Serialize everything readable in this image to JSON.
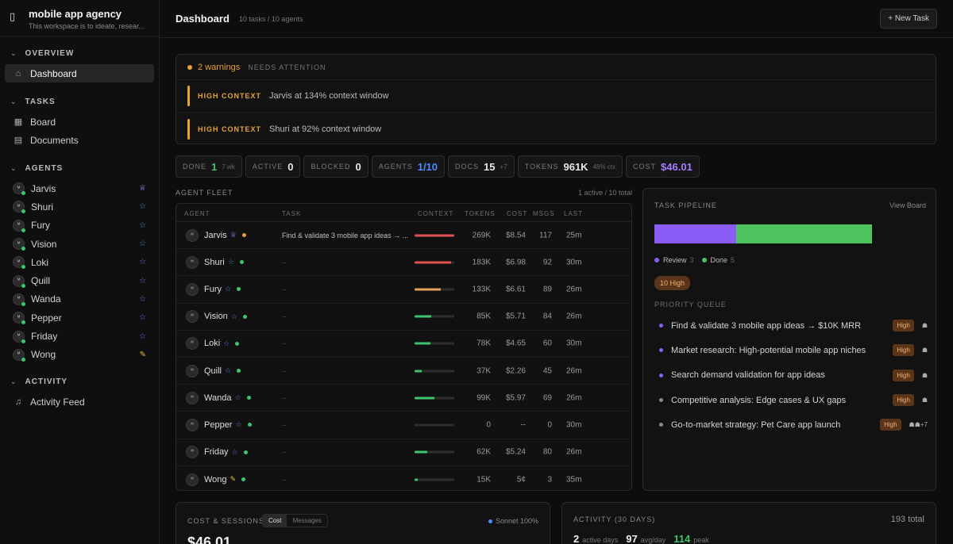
{
  "workspace": {
    "name": "mobile app agency",
    "description": "This workspace is to ideate, resear..."
  },
  "sidebar": {
    "overview_label": "OVERVIEW",
    "dashboard_label": "Dashboard",
    "tasks_label": "TASKS",
    "board_label": "Board",
    "documents_label": "Documents",
    "agents_label": "AGENTS",
    "activity_label": "ACTIVITY",
    "activity_feed_label": "Activity Feed",
    "agents": [
      {
        "name": "Jarvis",
        "badge": "♕"
      },
      {
        "name": "Shuri",
        "badge": "☆"
      },
      {
        "name": "Fury",
        "badge": "☆"
      },
      {
        "name": "Vision",
        "badge": "☆"
      },
      {
        "name": "Loki",
        "badge": "☆"
      },
      {
        "name": "Quill",
        "badge": "☆"
      },
      {
        "name": "Wanda",
        "badge": "☆"
      },
      {
        "name": "Pepper",
        "badge": "☆"
      },
      {
        "name": "Friday",
        "badge": "☆"
      },
      {
        "name": "Wong",
        "badge": "✎"
      }
    ]
  },
  "header": {
    "title": "Dashboard",
    "subtitle": "10 tasks / 10 agents",
    "new_task": "+ New Task"
  },
  "warnings": {
    "count": "2 warnings",
    "label": "NEEDS ATTENTION",
    "items": [
      {
        "kind": "HIGH CONTEXT",
        "text": "Jarvis at 134% context window"
      },
      {
        "kind": "HIGH CONTEXT",
        "text": "Shuri at 92% context window"
      }
    ]
  },
  "stats": [
    {
      "label": "DONE",
      "value": "1",
      "extra": "7 wk",
      "color": "#3ec46d"
    },
    {
      "label": "ACTIVE",
      "value": "0",
      "extra": "",
      "color": "#e6e6e6"
    },
    {
      "label": "BLOCKED",
      "value": "0",
      "extra": "",
      "color": "#e6e6e6"
    },
    {
      "label": "AGENTS",
      "value": "1/10",
      "extra": "",
      "color": "#4a8cff"
    },
    {
      "label": "DOCS",
      "value": "15",
      "extra": "+7",
      "color": "#e6e6e6"
    },
    {
      "label": "TOKENS",
      "value": "961K",
      "extra": "48% ctx",
      "color": "#e6e6e6"
    },
    {
      "label": "COST",
      "value": "$46.01",
      "extra": "",
      "color": "#a57cff"
    }
  ],
  "fleet": {
    "label": "AGENT FLEET",
    "count": "1 active / 10 total",
    "columns": [
      "AGENT",
      "TASK",
      "CONTEXT",
      "TOKENS",
      "COST",
      "MSGS",
      "LAST"
    ],
    "rows": [
      {
        "name": "Jarvis",
        "badge": "♕",
        "status": "#e6a335",
        "task": "Find & validate 3 mobile app ideas → ...",
        "ctx": 1.0,
        "ctx_color": "#e05252",
        "tokens": "269K",
        "cost": "$8.54",
        "msgs": "117",
        "last": "25m"
      },
      {
        "name": "Shuri",
        "badge": "☆",
        "status": "#3ec46d",
        "task": "--",
        "ctx": 0.92,
        "ctx_color": "#e05252",
        "tokens": "183K",
        "cost": "$6.98",
        "msgs": "92",
        "last": "30m"
      },
      {
        "name": "Fury",
        "badge": "☆",
        "status": "#3ec46d",
        "task": "--",
        "ctx": 0.66,
        "ctx_color": "#e6a05a",
        "tokens": "133K",
        "cost": "$6.61",
        "msgs": "89",
        "last": "26m"
      },
      {
        "name": "Vision",
        "badge": "☆",
        "status": "#3ec46d",
        "task": "--",
        "ctx": 0.42,
        "ctx_color": "#3ec46d",
        "tokens": "85K",
        "cost": "$5.71",
        "msgs": "84",
        "last": "26m"
      },
      {
        "name": "Loki",
        "badge": "☆",
        "status": "#3ec46d",
        "task": "--",
        "ctx": 0.39,
        "ctx_color": "#3ec46d",
        "tokens": "78K",
        "cost": "$4.65",
        "msgs": "60",
        "last": "30m"
      },
      {
        "name": "Quill",
        "badge": "☆",
        "status": "#3ec46d",
        "task": "--",
        "ctx": 0.18,
        "ctx_color": "#3ec46d",
        "tokens": "37K",
        "cost": "$2.26",
        "msgs": "45",
        "last": "26m"
      },
      {
        "name": "Wanda",
        "badge": "☆",
        "status": "#3ec46d",
        "task": "--",
        "ctx": 0.49,
        "ctx_color": "#3ec46d",
        "tokens": "99K",
        "cost": "$5.97",
        "msgs": "69",
        "last": "26m"
      },
      {
        "name": "Pepper",
        "badge": "☆",
        "status": "#3ec46d",
        "task": "--",
        "ctx": 0.0,
        "ctx_color": "#3ec46d",
        "tokens": "0",
        "cost": "--",
        "msgs": "0",
        "last": "30m"
      },
      {
        "name": "Friday",
        "badge": "☆",
        "status": "#3ec46d",
        "task": "--",
        "ctx": 0.31,
        "ctx_color": "#3ec46d",
        "tokens": "62K",
        "cost": "$5.24",
        "msgs": "80",
        "last": "26m"
      },
      {
        "name": "Wong",
        "badge": "✎",
        "status": "#3ec46d",
        "task": "--",
        "ctx": 0.08,
        "ctx_color": "#3ec46d",
        "tokens": "15K",
        "cost": "5¢",
        "msgs": "3",
        "last": "35m"
      }
    ]
  },
  "pipeline": {
    "label": "TASK PIPELINE",
    "link": "View Board",
    "segments": [
      {
        "name": "Review",
        "count": "3",
        "color": "#8b5cf6",
        "fraction": 0.375
      },
      {
        "name": "Done",
        "count": "5",
        "color": "#4fc35f",
        "fraction": 0.625
      }
    ],
    "high_badge": "10 High",
    "queue_label": "PRIORITY QUEUE",
    "queue": [
      {
        "title": "Find & validate 3 mobile app ideas → $10K MRR",
        "priority": "High",
        "dot": "#8b5cf6",
        "assignees": "☗"
      },
      {
        "title": "Market research: High-potential mobile app niches",
        "priority": "High",
        "dot": "#8b5cf6",
        "assignees": "☗"
      },
      {
        "title": "Search demand validation for app ideas",
        "priority": "High",
        "dot": "#8b5cf6",
        "assignees": "☗"
      },
      {
        "title": "Competitive analysis: Edge cases & UX gaps",
        "priority": "High",
        "dot": "#888888",
        "assignees": "☗"
      },
      {
        "title": "Go-to-market strategy: Pet Care app launch",
        "priority": "High",
        "dot": "#888888",
        "assignees": "☗☗+7"
      }
    ]
  },
  "cost_panel": {
    "label": "COST & SESSIONS",
    "tab_cost": "Cost",
    "tab_messages": "Messages",
    "model": "Sonnet 100%",
    "value": "$46.01"
  },
  "activity_panel": {
    "label": "ACTIVITY (30 DAYS)",
    "total": "193 total",
    "active_days": "2",
    "active_days_label": "active days",
    "avg": "97",
    "avg_label": "avg/day",
    "peak": "114",
    "peak_label": "peak"
  }
}
